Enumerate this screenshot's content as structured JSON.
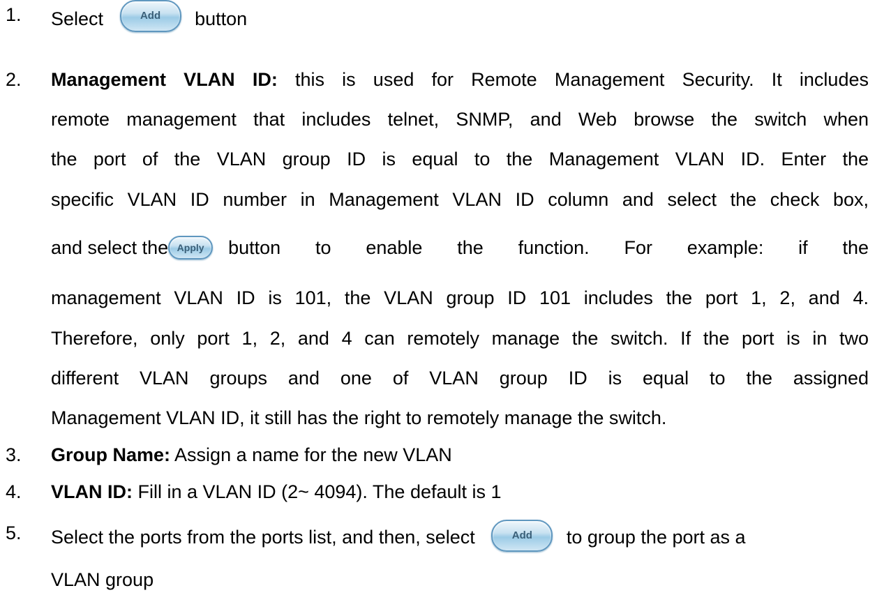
{
  "items": [
    {
      "num": "1.",
      "before": "Select",
      "button": "Add",
      "after": "button"
    },
    {
      "num": "2.",
      "bold": "Management VLAN ID:",
      "line1": "this is used for Remote Management Security. It includes",
      "line2": "remote management that includes telnet, SNMP, and Web browse the switch when",
      "line3": "the port of the VLAN group ID is equal to the Management VLAN ID. Enter the",
      "line4": "specific VLAN ID number in Management VLAN ID column and select the check box,",
      "line5_before": "and select the",
      "line5_button": "Apply",
      "line5_after": "button to enable the function. For example: if the",
      "line6": "management VLAN ID is 101, the VLAN group ID 101 includes the port 1, 2, and 4.",
      "line7": "Therefore, only port 1, 2, and 4 can remotely manage the switch. If the port is in two",
      "line8": "different VLAN groups and one of VLAN group ID is equal to the assigned",
      "line9": "Management VLAN ID, it still has the right to remotely manage the switch."
    },
    {
      "num": "3.",
      "bold": "Group Name:",
      "text": "Assign a name for the new VLAN"
    },
    {
      "num": "4.",
      "bold": "VLAN ID:",
      "text": "Fill in a VLAN ID (2~ 4094). The default is 1"
    },
    {
      "num": "5.",
      "before": "Select the ports from the ports list, and then, select",
      "button": "Add",
      "after": "to group the port as a",
      "line2": "VLAN group"
    }
  ]
}
